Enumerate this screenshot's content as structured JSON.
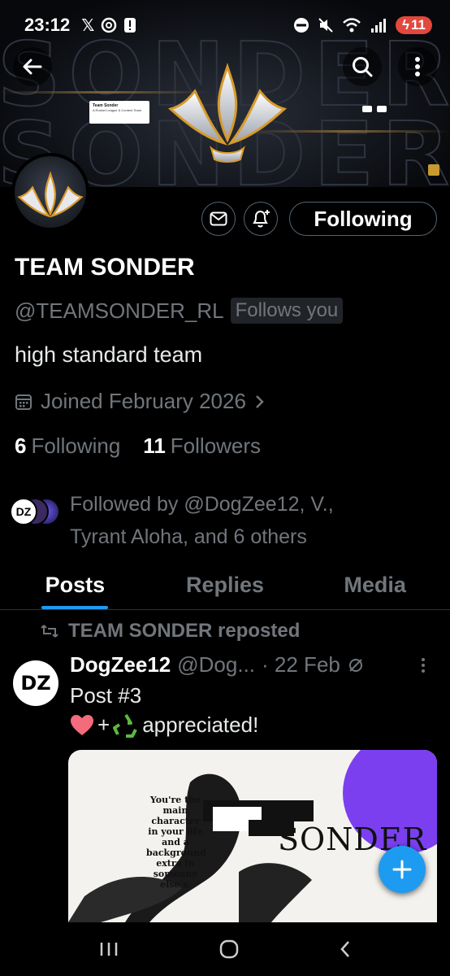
{
  "status_bar": {
    "time": "23:12",
    "left_icons": [
      "x-logo-icon",
      "threads-icon",
      "alert-icon"
    ],
    "right_icons": [
      "do-not-disturb-icon",
      "mute-icon",
      "wifi-icon",
      "signal-icon"
    ],
    "battery": "11"
  },
  "banner": {
    "card_title": "Team Sonder",
    "card_subtitle": "A Rocket League & Content Team"
  },
  "header": {
    "back_icon": "back-arrow-icon",
    "search_icon": "search-icon",
    "more_icon": "more-vertical-icon"
  },
  "profile": {
    "name": "TEAM SONDER",
    "handle": "@TEAMSONDER_RL",
    "follows_you": "Follows you",
    "bio": "high standard team",
    "joined": "Joined February 2026",
    "following_count": "6",
    "following_label": "Following",
    "followers_count": "11",
    "followers_label": "Followers",
    "followed_by": "Followed by @DogZee12, V., Tyrant Aloha, and 6 others",
    "following_button": "Following"
  },
  "tabs": [
    {
      "label": "Posts"
    },
    {
      "label": "Replies"
    },
    {
      "label": "Media"
    }
  ],
  "post": {
    "repost_label": "TEAM SONDER reposted",
    "author": "DogZee12",
    "handle": "@Dog...",
    "date": "· 22 Feb",
    "line1": "Post #3",
    "line2_text": "appreciated!",
    "plus": "+",
    "image_quote": "You're the main character in your life and a background extra in someone else's.",
    "image_brand": "SONDER"
  },
  "colors": {
    "accent": "#1d9bf0",
    "muted": "#71767b",
    "background": "#000000"
  }
}
